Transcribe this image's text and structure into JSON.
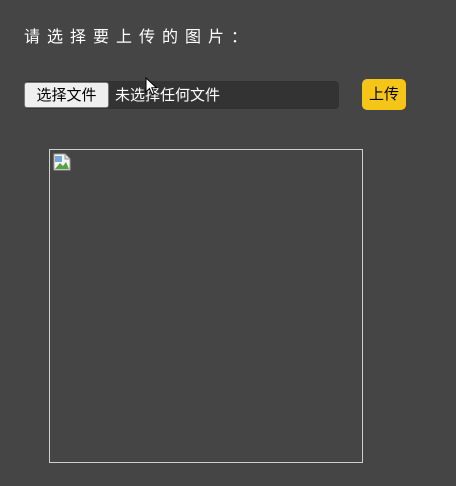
{
  "prompt": {
    "text": "请选择要上传的图片："
  },
  "file_input": {
    "button_label": "选择文件",
    "status_text": "未选择任何文件"
  },
  "upload_button": {
    "label": "上传"
  },
  "preview": {
    "icon": "broken-image-icon"
  },
  "colors": {
    "background": "#454545",
    "file_bar": "#333333",
    "upload_accent": "#f5c518",
    "text": "#ffffff"
  }
}
